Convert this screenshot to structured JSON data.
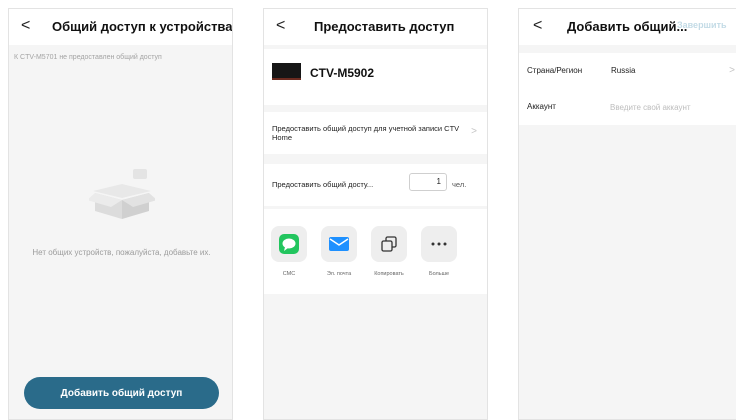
{
  "screen1": {
    "title": "Общий доступ к устройствам",
    "notice": "К CTV-M5701 не предоставлен общий доступ",
    "empty_text": "Нет общих устройств, пожалуйста, добавьте их.",
    "add_button": "Добавить общий доступ"
  },
  "screen2": {
    "title": "Предоставить доступ",
    "device_name": "CTV-M5902",
    "account_share_label": "Предоставить общий доступ для учетной записи CTV Home",
    "count_label": "Предоставить общий досту...",
    "count_value": "1",
    "count_unit": "чел.",
    "share_options": [
      {
        "label": "СМС",
        "icon": "sms-icon"
      },
      {
        "label": "Эл. почта",
        "icon": "mail-icon"
      },
      {
        "label": "Копировать",
        "icon": "copy-icon"
      },
      {
        "label": "Больше",
        "icon": "more-icon"
      }
    ]
  },
  "screen3": {
    "title": "Добавить общий...",
    "finish_label": "Завершить",
    "country_label": "Страна/Регион",
    "country_value": "Russia",
    "account_label": "Аккаунт",
    "account_placeholder": "Введите свой аккаунт"
  },
  "colors": {
    "primary": "#2a6b8a",
    "background": "#f5f5f5",
    "sms_green": "#22c55e",
    "mail_blue": "#1e90ff",
    "finish_disabled": "#c3dbe6"
  }
}
